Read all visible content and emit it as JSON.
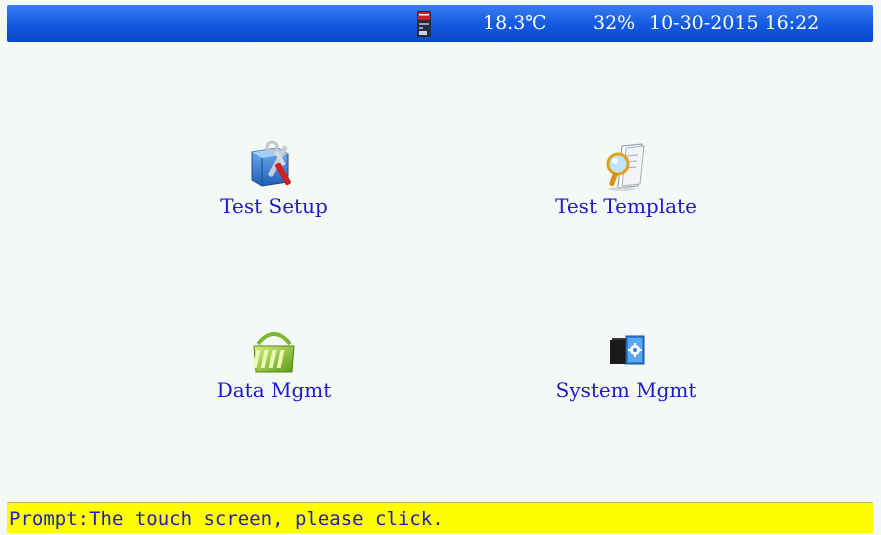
{
  "status_bar": {
    "temperature": "18.3℃",
    "humidity": "32%",
    "datetime": "10-30-2015 16:22",
    "sd_card_icon": "sd-card-icon",
    "background_color": "#1259e0"
  },
  "menu": {
    "items": [
      {
        "label": "Test Setup",
        "icon": "tools-icon"
      },
      {
        "label": "Test Template",
        "icon": "magnifier-document-icon"
      },
      {
        "label": "Data Mgmt",
        "icon": "data-folder-icon"
      },
      {
        "label": "System Mgmt",
        "icon": "system-settings-icon"
      }
    ],
    "label_color": "#1a1acc"
  },
  "prompt_bar": {
    "text": "Prompt:The touch screen, please click.",
    "background_color": "#ffff00"
  }
}
